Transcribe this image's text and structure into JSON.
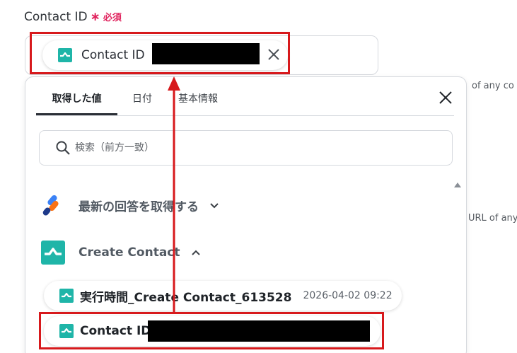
{
  "field": {
    "label": "Contact ID",
    "required_mark": "∗",
    "required_text": "必須"
  },
  "selected_chip": {
    "label": "Contact ID",
    "redacted": true,
    "icon": "app-logo-icon"
  },
  "background_text": {
    "line1": "of any co",
    "line2": "URL of any"
  },
  "panel": {
    "tabs": [
      {
        "label": "取得した値",
        "active": true
      },
      {
        "label": "日付",
        "active": false
      },
      {
        "label": "基本情報",
        "active": false
      }
    ],
    "search_placeholder": "検索（前方一致）",
    "sections": [
      {
        "label": "最新の回答を取得する",
        "icon": "form-app-icon",
        "expanded": false
      },
      {
        "label": "Create Contact",
        "icon": "app-logo-icon",
        "expanded": true
      }
    ],
    "items": [
      {
        "label": "実行時間_Create Contact_613528",
        "value": "2026-04-02 09:22"
      },
      {
        "label": "Contact ID",
        "value": "",
        "redacted": true
      }
    ]
  },
  "colors": {
    "highlight": "#d7191c",
    "required": "#e0245e",
    "app_logo": "#1fb5a8"
  }
}
